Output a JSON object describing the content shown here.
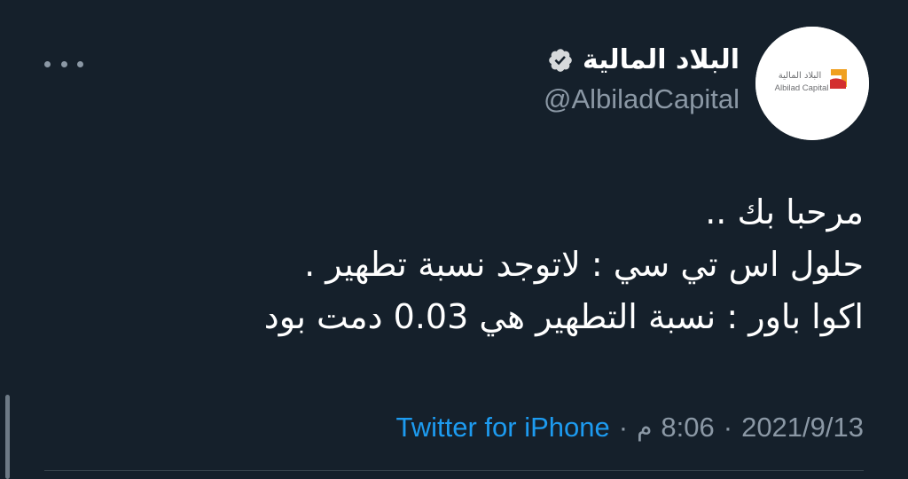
{
  "tweet": {
    "author": {
      "display_name": "البلاد المالية",
      "handle": "@AlbiladCapital",
      "verified": true,
      "avatar": {
        "logo_text_arabic": "البلاد المالية",
        "logo_text_english": "Albilad Capital"
      }
    },
    "more_icon": "more-horizontal-icon",
    "text_lines": [
      "مرحبا بك ..",
      "حلول اس تي سي : لاتوجد نسبة تطهير .",
      "اكوا باور : نسبة التطهير هي 0.03 دمت بود"
    ],
    "meta": {
      "date": "2021/9/13",
      "separator": "·",
      "time": "8:06",
      "ampm": "م",
      "source": "Twitter for iPhone"
    }
  },
  "colors": {
    "background": "#15202b",
    "primary_text": "#ffffff",
    "secondary_text": "#8b98a5",
    "link": "#1d9bf0",
    "logo_orange": "#f0a020",
    "logo_red": "#d32f2f"
  }
}
